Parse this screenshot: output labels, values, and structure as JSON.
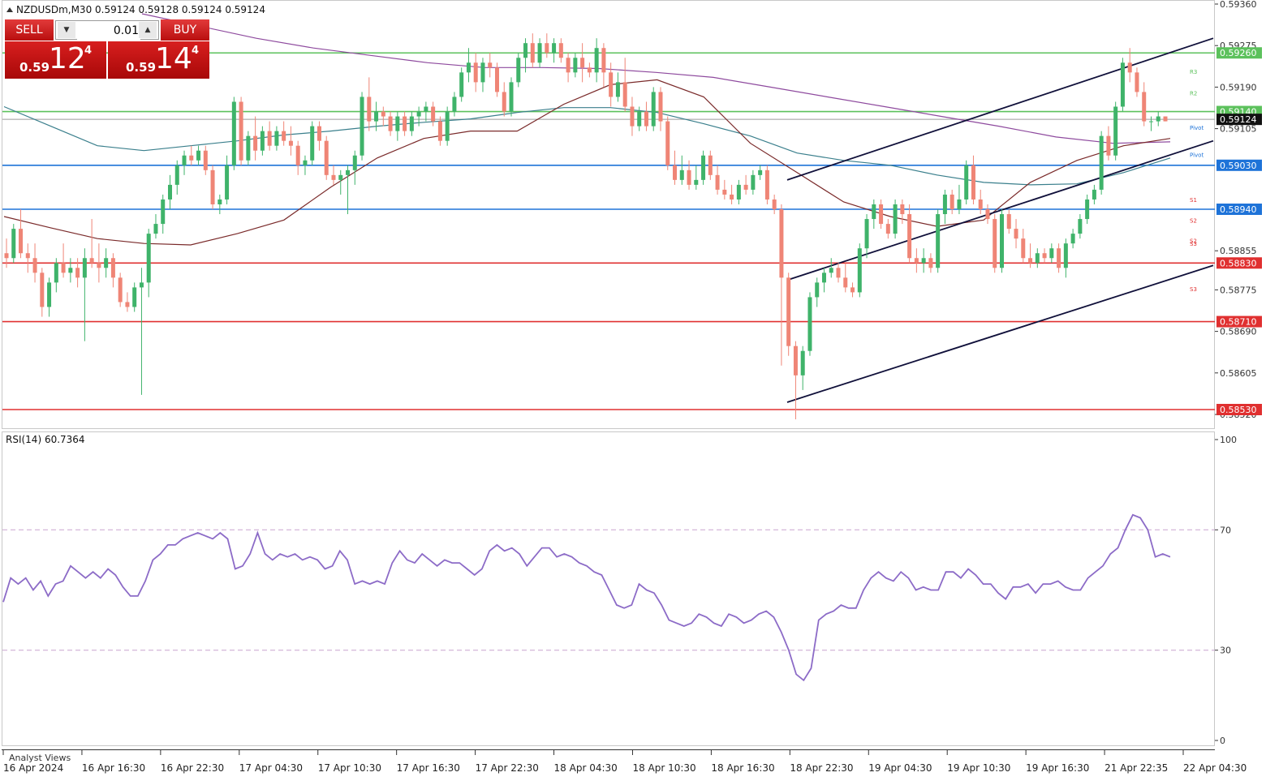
{
  "header": {
    "symbol_line": "NZDUSDm,M30  0.59124 0.59128 0.59124 0.59124"
  },
  "trade_panel": {
    "sell_label": "SELL",
    "buy_label": "BUY",
    "lot": "0.01",
    "sell_price": {
      "prefix": "0.59",
      "big": "12",
      "sup": "4"
    },
    "buy_price": {
      "prefix": "0.59",
      "big": "14",
      "sup": "4"
    }
  },
  "price_axis": {
    "ticks": [
      "0.59360",
      "0.59275",
      "0.59190",
      "0.59105",
      "0.58855",
      "0.58775",
      "0.58690",
      "0.58605",
      "0.58520"
    ],
    "current_price": "0.59124"
  },
  "levels": [
    {
      "label": "0.59260",
      "value": 0.5926,
      "color": "#5cc15c",
      "kind": "resistance"
    },
    {
      "label": "0.59140",
      "value": 0.5914,
      "color": "#5cc15c",
      "kind": "resistance"
    },
    {
      "label": "0.59030",
      "value": 0.5903,
      "color": "#1e73d8",
      "kind": "support"
    },
    {
      "label": "0.58940",
      "value": 0.5894,
      "color": "#1e73d8",
      "kind": "support"
    },
    {
      "label": "0.58830",
      "value": 0.5883,
      "color": "#e03030",
      "kind": "support"
    },
    {
      "label": "0.58710",
      "value": 0.5871,
      "color": "#e03030",
      "kind": "support"
    },
    {
      "label": "0.58530",
      "value": 0.5853,
      "color": "#e03030",
      "kind": "support"
    }
  ],
  "pivot_labels": [
    {
      "text": "R3",
      "value": 0.59222,
      "color": "#5cc15c"
    },
    {
      "text": "R2",
      "value": 0.59178,
      "color": "#5cc15c"
    },
    {
      "text": "Pivot",
      "value": 0.59108,
      "color": "#1e73d8"
    },
    {
      "text": "Pivot",
      "value": 0.59052,
      "color": "#1e73d8"
    },
    {
      "text": "S1",
      "value": 0.5896,
      "color": "#e03030"
    },
    {
      "text": "S2",
      "value": 0.58918,
      "color": "#e03030"
    },
    {
      "text": "S2",
      "value": 0.58876,
      "color": "#e03030"
    },
    {
      "text": "S3",
      "value": 0.5887,
      "color": "#e03030"
    },
    {
      "text": "S3",
      "value": 0.58777,
      "color": "#e03030"
    }
  ],
  "time_axis": [
    "16 Apr 2024",
    "16 Apr 16:30",
    "16 Apr 22:30",
    "17 Apr 04:30",
    "17 Apr 10:30",
    "17 Apr 16:30",
    "17 Apr 22:30",
    "18 Apr 04:30",
    "18 Apr 10:30",
    "18 Apr 16:30",
    "18 Apr 22:30",
    "19 Apr 04:30",
    "19 Apr 10:30",
    "19 Apr 16:30",
    "21 Apr 22:35",
    "22 Apr 04:30"
  ],
  "rsi": {
    "label": "RSI(14) 60.7364",
    "ticks": [
      "100",
      "70",
      "30",
      "0"
    ],
    "levels": [
      70,
      30
    ]
  },
  "analyst_views": "Analyst Views",
  "colors": {
    "bull": "#3fb36a",
    "bear": "#ef8576",
    "ma_fast": "#7a2a2a",
    "ma_mid": "#3a7f8c",
    "ma_slow": "#8e4a9e",
    "rsi": "#8c6bc7",
    "channel": "#10103a"
  },
  "chart_data": {
    "type": "candlestick",
    "title": "NZDUSDm,M30",
    "timeframe": "M30",
    "ylim": [
      0.5848,
      0.5936
    ],
    "candles_ohlc": [
      [
        0.5885,
        0.5888,
        0.5882,
        0.5884
      ],
      [
        0.5884,
        0.5891,
        0.5883,
        0.589
      ],
      [
        0.589,
        0.5894,
        0.5884,
        0.5885
      ],
      [
        0.5885,
        0.5887,
        0.5881,
        0.5884
      ],
      [
        0.5884,
        0.5887,
        0.5879,
        0.5881
      ],
      [
        0.5881,
        0.5882,
        0.5872,
        0.5874
      ],
      [
        0.5874,
        0.588,
        0.5872,
        0.5879
      ],
      [
        0.5879,
        0.5884,
        0.5877,
        0.5883
      ],
      [
        0.5883,
        0.5887,
        0.588,
        0.5881
      ],
      [
        0.5881,
        0.5884,
        0.5879,
        0.5882
      ],
      [
        0.5882,
        0.5884,
        0.5878,
        0.588
      ],
      [
        0.588,
        0.5886,
        0.5867,
        0.5884
      ],
      [
        0.5884,
        0.5892,
        0.5882,
        0.5883
      ],
      [
        0.5883,
        0.5887,
        0.5879,
        0.5882
      ],
      [
        0.5882,
        0.5886,
        0.588,
        0.5884
      ],
      [
        0.5884,
        0.5885,
        0.5878,
        0.588
      ],
      [
        0.588,
        0.5881,
        0.5874,
        0.5875
      ],
      [
        0.5875,
        0.5877,
        0.5873,
        0.5874
      ],
      [
        0.5874,
        0.5879,
        0.5873,
        0.5878
      ],
      [
        0.5878,
        0.5882,
        0.5856,
        0.5879
      ],
      [
        0.5879,
        0.589,
        0.5876,
        0.5889
      ],
      [
        0.5889,
        0.5893,
        0.5888,
        0.5891
      ],
      [
        0.5891,
        0.5897,
        0.5889,
        0.5896
      ],
      [
        0.5896,
        0.5901,
        0.5894,
        0.5899
      ],
      [
        0.5899,
        0.5904,
        0.5897,
        0.5903
      ],
      [
        0.5903,
        0.5906,
        0.5901,
        0.5905
      ],
      [
        0.5905,
        0.5907,
        0.5903,
        0.5904
      ],
      [
        0.5904,
        0.5907,
        0.5903,
        0.5906
      ],
      [
        0.5906,
        0.5907,
        0.5901,
        0.5902
      ],
      [
        0.5902,
        0.5903,
        0.5894,
        0.5895
      ],
      [
        0.5895,
        0.5897,
        0.5893,
        0.5896
      ],
      [
        0.5896,
        0.5905,
        0.5895,
        0.5903
      ],
      [
        0.5903,
        0.5917,
        0.5902,
        0.5916
      ],
      [
        0.5916,
        0.5917,
        0.5903,
        0.5904
      ],
      [
        0.5904,
        0.591,
        0.5903,
        0.5909
      ],
      [
        0.5909,
        0.5913,
        0.5904,
        0.5906
      ],
      [
        0.5906,
        0.5911,
        0.5905,
        0.591
      ],
      [
        0.591,
        0.5912,
        0.5906,
        0.5907
      ],
      [
        0.5907,
        0.5911,
        0.5906,
        0.591
      ],
      [
        0.591,
        0.5912,
        0.5907,
        0.5908
      ],
      [
        0.5908,
        0.5911,
        0.5905,
        0.5907
      ],
      [
        0.5907,
        0.5908,
        0.5901,
        0.5903
      ],
      [
        0.5903,
        0.5905,
        0.5901,
        0.5904
      ],
      [
        0.5904,
        0.5912,
        0.5903,
        0.5911
      ],
      [
        0.5911,
        0.5912,
        0.5906,
        0.5908
      ],
      [
        0.5908,
        0.5909,
        0.59,
        0.5901
      ],
      [
        0.5901,
        0.5903,
        0.5899,
        0.59
      ],
      [
        0.59,
        0.5902,
        0.5897,
        0.5901
      ],
      [
        0.5901,
        0.5903,
        0.5893,
        0.5902
      ],
      [
        0.5902,
        0.5906,
        0.5899,
        0.5905
      ],
      [
        0.5905,
        0.5918,
        0.5904,
        0.5917
      ],
      [
        0.5917,
        0.5921,
        0.591,
        0.5912
      ],
      [
        0.5912,
        0.5916,
        0.591,
        0.5914
      ],
      [
        0.5914,
        0.5915,
        0.5911,
        0.5913
      ],
      [
        0.5913,
        0.5914,
        0.5909,
        0.591
      ],
      [
        0.591,
        0.5914,
        0.5908,
        0.5913
      ],
      [
        0.5913,
        0.5914,
        0.5909,
        0.591
      ],
      [
        0.591,
        0.5914,
        0.5909,
        0.5913
      ],
      [
        0.5913,
        0.5915,
        0.5911,
        0.5914
      ],
      [
        0.5914,
        0.5916,
        0.5912,
        0.5915
      ],
      [
        0.5915,
        0.5916,
        0.5911,
        0.5912
      ],
      [
        0.5912,
        0.5913,
        0.5907,
        0.5908
      ],
      [
        0.5908,
        0.5915,
        0.5907,
        0.5914
      ],
      [
        0.5914,
        0.5918,
        0.5913,
        0.5917
      ],
      [
        0.5917,
        0.5923,
        0.5916,
        0.5922
      ],
      [
        0.5922,
        0.5927,
        0.592,
        0.5924
      ],
      [
        0.5924,
        0.5926,
        0.5918,
        0.592
      ],
      [
        0.592,
        0.5925,
        0.5918,
        0.5924
      ],
      [
        0.5924,
        0.5926,
        0.5921,
        0.5923
      ],
      [
        0.5923,
        0.5924,
        0.5917,
        0.5918
      ],
      [
        0.5918,
        0.592,
        0.5913,
        0.5914
      ],
      [
        0.5914,
        0.5921,
        0.5913,
        0.592
      ],
      [
        0.592,
        0.5926,
        0.5919,
        0.5925
      ],
      [
        0.5925,
        0.5929,
        0.5922,
        0.5928
      ],
      [
        0.5928,
        0.593,
        0.5923,
        0.5924
      ],
      [
        0.5924,
        0.5929,
        0.5923,
        0.5928
      ],
      [
        0.5928,
        0.593,
        0.5925,
        0.5926
      ],
      [
        0.5926,
        0.5929,
        0.5924,
        0.5928
      ],
      [
        0.5928,
        0.5929,
        0.5924,
        0.5925
      ],
      [
        0.5925,
        0.5926,
        0.592,
        0.5922
      ],
      [
        0.5922,
        0.5926,
        0.5921,
        0.5925
      ],
      [
        0.5925,
        0.5928,
        0.592,
        0.5923
      ],
      [
        0.5923,
        0.5924,
        0.5921,
        0.5922
      ],
      [
        0.5922,
        0.5929,
        0.592,
        0.5927
      ],
      [
        0.5927,
        0.5928,
        0.5919,
        0.5922
      ],
      [
        0.5922,
        0.5924,
        0.5915,
        0.5917
      ],
      [
        0.5917,
        0.5922,
        0.5916,
        0.592
      ],
      [
        0.592,
        0.5925,
        0.5914,
        0.5915
      ],
      [
        0.5915,
        0.5917,
        0.5909,
        0.5911
      ],
      [
        0.5911,
        0.5915,
        0.591,
        0.5914
      ],
      [
        0.5914,
        0.5916,
        0.591,
        0.5911
      ],
      [
        0.5911,
        0.5919,
        0.591,
        0.5918
      ],
      [
        0.5918,
        0.5919,
        0.591,
        0.5912
      ],
      [
        0.5912,
        0.5913,
        0.5902,
        0.5903
      ],
      [
        0.5903,
        0.5906,
        0.5899,
        0.59
      ],
      [
        0.59,
        0.5905,
        0.5899,
        0.5902
      ],
      [
        0.5902,
        0.5904,
        0.5898,
        0.5899
      ],
      [
        0.5899,
        0.5903,
        0.5898,
        0.59
      ],
      [
        0.59,
        0.5906,
        0.5899,
        0.5905
      ],
      [
        0.5905,
        0.5906,
        0.59,
        0.5901
      ],
      [
        0.5901,
        0.5903,
        0.5897,
        0.5898
      ],
      [
        0.5898,
        0.59,
        0.5896,
        0.5897
      ],
      [
        0.5897,
        0.5899,
        0.5895,
        0.5896
      ],
      [
        0.5896,
        0.59,
        0.5895,
        0.5899
      ],
      [
        0.5899,
        0.5901,
        0.5897,
        0.5898
      ],
      [
        0.5898,
        0.5902,
        0.5897,
        0.5901
      ],
      [
        0.5901,
        0.5903,
        0.59,
        0.5902
      ],
      [
        0.5902,
        0.5903,
        0.5895,
        0.5896
      ],
      [
        0.5896,
        0.5897,
        0.5893,
        0.5894
      ],
      [
        0.5894,
        0.5895,
        0.5862,
        0.588
      ],
      [
        0.588,
        0.5881,
        0.5864,
        0.5866
      ],
      [
        0.5866,
        0.5867,
        0.5851,
        0.586
      ],
      [
        0.586,
        0.5866,
        0.5857,
        0.5865
      ],
      [
        0.5865,
        0.5877,
        0.5864,
        0.5876
      ],
      [
        0.5876,
        0.588,
        0.5874,
        0.5879
      ],
      [
        0.5879,
        0.5882,
        0.5877,
        0.5881
      ],
      [
        0.5881,
        0.5884,
        0.588,
        0.5882
      ],
      [
        0.5882,
        0.5883,
        0.5879,
        0.588
      ],
      [
        0.588,
        0.5883,
        0.5877,
        0.5878
      ],
      [
        0.5878,
        0.5879,
        0.5876,
        0.5877
      ],
      [
        0.5877,
        0.5887,
        0.5876,
        0.5886
      ],
      [
        0.5886,
        0.5893,
        0.5884,
        0.5892
      ],
      [
        0.5892,
        0.5896,
        0.589,
        0.5895
      ],
      [
        0.5895,
        0.5896,
        0.589,
        0.5891
      ],
      [
        0.5891,
        0.5892,
        0.5888,
        0.5889
      ],
      [
        0.5889,
        0.5896,
        0.5888,
        0.5895
      ],
      [
        0.5895,
        0.5896,
        0.5891,
        0.5893
      ],
      [
        0.5893,
        0.5895,
        0.5883,
        0.5884
      ],
      [
        0.5884,
        0.5886,
        0.5881,
        0.5883
      ],
      [
        0.5883,
        0.5886,
        0.5881,
        0.5884
      ],
      [
        0.5884,
        0.5885,
        0.5881,
        0.5882
      ],
      [
        0.5882,
        0.5894,
        0.5881,
        0.5893
      ],
      [
        0.5893,
        0.5898,
        0.5891,
        0.5897
      ],
      [
        0.5897,
        0.5898,
        0.5893,
        0.5894
      ],
      [
        0.5894,
        0.5899,
        0.5893,
        0.5896
      ],
      [
        0.5896,
        0.5904,
        0.5895,
        0.5903
      ],
      [
        0.5903,
        0.5905,
        0.5895,
        0.5896
      ],
      [
        0.5896,
        0.5898,
        0.5893,
        0.5894
      ],
      [
        0.5894,
        0.5895,
        0.5891,
        0.5892
      ],
      [
        0.5892,
        0.5893,
        0.5881,
        0.5882
      ],
      [
        0.5882,
        0.5894,
        0.5881,
        0.5893
      ],
      [
        0.5893,
        0.5894,
        0.5889,
        0.589
      ],
      [
        0.589,
        0.5892,
        0.5886,
        0.5888
      ],
      [
        0.5888,
        0.589,
        0.5883,
        0.5884
      ],
      [
        0.5884,
        0.5887,
        0.5882,
        0.5883
      ],
      [
        0.5883,
        0.5886,
        0.5882,
        0.5885
      ],
      [
        0.5885,
        0.5886,
        0.5883,
        0.5884
      ],
      [
        0.5884,
        0.5887,
        0.5883,
        0.5886
      ],
      [
        0.5886,
        0.5887,
        0.5881,
        0.5882
      ],
      [
        0.5882,
        0.5888,
        0.588,
        0.5887
      ],
      [
        0.5887,
        0.589,
        0.5886,
        0.5889
      ],
      [
        0.5889,
        0.5893,
        0.5888,
        0.5892
      ],
      [
        0.5892,
        0.5897,
        0.5891,
        0.5896
      ],
      [
        0.5896,
        0.5899,
        0.5895,
        0.5898
      ],
      [
        0.5898,
        0.591,
        0.5897,
        0.5909
      ],
      [
        0.5909,
        0.5911,
        0.5904,
        0.5905
      ],
      [
        0.5905,
        0.5916,
        0.5904,
        0.5915
      ],
      [
        0.5915,
        0.5925,
        0.5914,
        0.5924
      ],
      [
        0.5924,
        0.5927,
        0.592,
        0.5922
      ],
      [
        0.5922,
        0.5923,
        0.5917,
        0.5918
      ],
      [
        0.5918,
        0.592,
        0.5911,
        0.5912
      ],
      [
        0.5912,
        0.5913,
        0.591,
        0.5912
      ],
      [
        0.5912,
        0.5914,
        0.5911,
        0.5913
      ],
      [
        0.5913,
        0.5913,
        0.5912,
        0.5912
      ]
    ],
    "rsi_values": [
      46,
      54,
      52,
      54,
      50,
      53,
      48,
      52,
      53,
      58,
      56,
      54,
      56,
      54,
      57,
      55,
      51,
      48,
      48,
      53,
      60,
      62,
      65,
      65,
      67,
      68,
      69,
      68,
      67,
      69,
      67,
      57,
      58,
      62,
      69,
      62,
      60,
      62,
      61,
      62,
      60,
      61,
      60,
      57,
      58,
      63,
      60,
      52,
      53,
      52,
      53,
      52,
      59,
      63,
      60,
      59,
      62,
      60,
      58,
      60,
      59,
      59,
      57,
      55,
      57,
      63,
      65,
      63,
      64,
      62,
      58,
      61,
      64,
      64,
      61,
      62,
      61,
      59,
      58,
      56,
      55,
      50,
      45,
      44,
      45,
      52,
      50,
      49,
      45,
      40,
      39,
      38,
      39,
      42,
      41,
      39,
      38,
      42,
      41,
      39,
      40,
      42,
      43,
      41,
      36,
      30,
      22,
      20,
      24,
      40,
      42,
      43,
      45,
      44,
      44,
      50,
      54,
      56,
      54,
      53,
      56,
      54,
      50,
      51,
      50,
      50,
      56,
      56,
      54,
      57,
      55,
      52,
      52,
      49,
      47,
      51,
      51,
      52,
      49,
      52,
      52,
      53,
      51,
      50,
      50,
      54,
      56,
      58,
      62,
      64,
      70,
      75,
      74,
      70,
      61,
      62,
      61
    ],
    "ma_fast": [
      0.58925,
      0.58902,
      0.5888,
      0.5887,
      0.58867,
      0.5889,
      0.58918,
      0.58985,
      0.59045,
      0.59085,
      0.591,
      0.591,
      0.59155,
      0.59195,
      0.59205,
      0.5917,
      0.59075,
      0.59015,
      0.58955,
      0.58925,
      0.58905,
      0.58918,
      0.58995,
      0.5904,
      0.5907,
      0.59085
    ],
    "ma_mid": [
      0.5915,
      0.5911,
      0.5907,
      0.5906,
      0.5907,
      0.5908,
      0.59092,
      0.591,
      0.5911,
      0.59118,
      0.59125,
      0.59138,
      0.59148,
      0.59148,
      0.59138,
      0.59115,
      0.5909,
      0.59055,
      0.5904,
      0.5903,
      0.5901,
      0.58995,
      0.5899,
      0.58992,
      0.59015,
      0.59045
    ],
    "ma_slow": [
      0.5934,
      0.59315,
      0.5929,
      0.5927,
      0.59255,
      0.5924,
      0.5923,
      0.5923,
      0.59228,
      0.5922,
      0.5921,
      0.5919,
      0.5917,
      0.5915,
      0.5913,
      0.5911,
      0.59088,
      0.59075,
      0.59078
    ],
    "channel_lines": [
      [
        0.59,
        0.5929
      ],
      [
        0.58795,
        0.5908
      ],
      [
        0.58545,
        0.58825
      ]
    ]
  }
}
